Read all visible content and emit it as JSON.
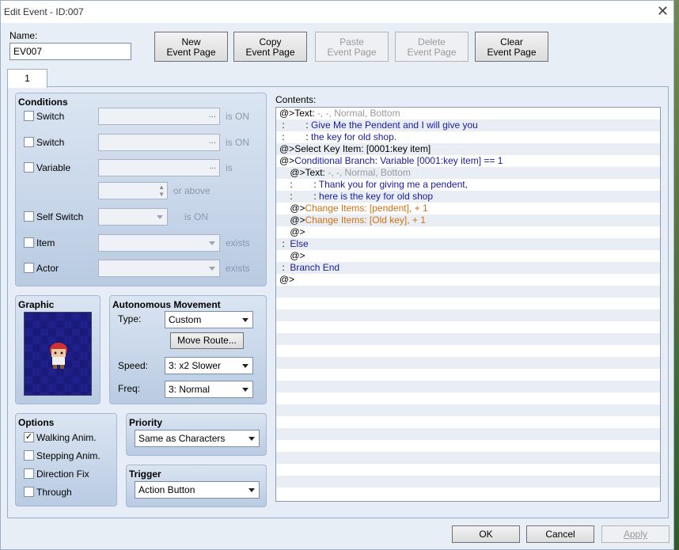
{
  "window": {
    "title": "Edit Event - ID:007"
  },
  "name": {
    "label": "Name:",
    "value": "EV007"
  },
  "toolbar": {
    "new": [
      "New",
      "Event Page"
    ],
    "copy": [
      "Copy",
      "Event Page"
    ],
    "paste": [
      "Paste",
      "Event Page"
    ],
    "delete": [
      "Delete",
      "Event Page"
    ],
    "clear": [
      "Clear",
      "Event Page"
    ]
  },
  "tabs": [
    {
      "label": "1"
    }
  ],
  "conditions": {
    "title": "Conditions",
    "switch1": {
      "label": "Switch",
      "suffix": "is ON"
    },
    "switch2": {
      "label": "Switch",
      "suffix": "is ON"
    },
    "variable": {
      "label": "Variable",
      "suffix": "is",
      "suffix2": "or above"
    },
    "self_switch": {
      "label": "Self Switch",
      "suffix": "is ON"
    },
    "item": {
      "label": "Item",
      "suffix": "exists"
    },
    "actor": {
      "label": "Actor",
      "suffix": "exists"
    },
    "ellipsis": "..."
  },
  "graphic": {
    "title": "Graphic"
  },
  "movement": {
    "title": "Autonomous Movement",
    "type_label": "Type:",
    "type_value": "Custom",
    "move_route": "Move Route...",
    "speed_label": "Speed:",
    "speed_value": "3: x2 Slower",
    "freq_label": "Freq:",
    "freq_value": "3: Normal"
  },
  "options": {
    "title": "Options",
    "walking": {
      "label": "Walking Anim.",
      "checked": true
    },
    "stepping": {
      "label": "Stepping Anim.",
      "checked": false
    },
    "direction": {
      "label": "Direction Fix",
      "checked": false
    },
    "through": {
      "label": "Through",
      "checked": false
    },
    "checkmark": "✓"
  },
  "priority": {
    "title": "Priority",
    "value": "Same as Characters"
  },
  "trigger": {
    "title": "Trigger",
    "value": "Action Button"
  },
  "contents": {
    "label": "Contents:",
    "lines": [
      [
        [
          "@>Text: ",
          "c-black"
        ],
        [
          "-, -, Normal, Bottom",
          "c-gray"
        ]
      ],
      [
        [
          " :        : ",
          "c-black"
        ],
        [
          "Give Me the Pendent and I will give you",
          "c-blue"
        ]
      ],
      [
        [
          " :        : ",
          "c-black"
        ],
        [
          "the key for old shop.",
          "c-blue"
        ]
      ],
      [
        [
          "@>Select Key Item: [0001:key item]",
          "c-black"
        ]
      ],
      [
        [
          "@>",
          "c-black"
        ],
        [
          "Conditional Branch: Variable [0001:key item] == 1",
          "c-blue"
        ]
      ],
      [
        [
          "    @>Text: ",
          "c-black"
        ],
        [
          "-, -, Normal, Bottom",
          "c-gray"
        ]
      ],
      [
        [
          "    :        : ",
          "c-black"
        ],
        [
          "Thank you for giving me a pendent,",
          "c-blue"
        ]
      ],
      [
        [
          "    :        : ",
          "c-black"
        ],
        [
          "here is the key for old shop",
          "c-blue"
        ]
      ],
      [
        [
          "    @>",
          "c-black"
        ],
        [
          "Change Items: [pendent], + 1",
          "c-orange"
        ]
      ],
      [
        [
          "    @>",
          "c-black"
        ],
        [
          "Change Items: [Old key], + 1",
          "c-orange"
        ]
      ],
      [
        [
          "    @>",
          "c-black"
        ]
      ],
      [
        [
          " :  ",
          "c-black"
        ],
        [
          "Else",
          "c-blue"
        ]
      ],
      [
        [
          "    @>",
          "c-black"
        ]
      ],
      [
        [
          " :  ",
          "c-black"
        ],
        [
          "Branch End",
          "c-blue"
        ]
      ],
      [
        [
          "@>",
          "c-black"
        ]
      ]
    ]
  },
  "footer": {
    "ok": "OK",
    "cancel": "Cancel",
    "apply": "Apply"
  }
}
